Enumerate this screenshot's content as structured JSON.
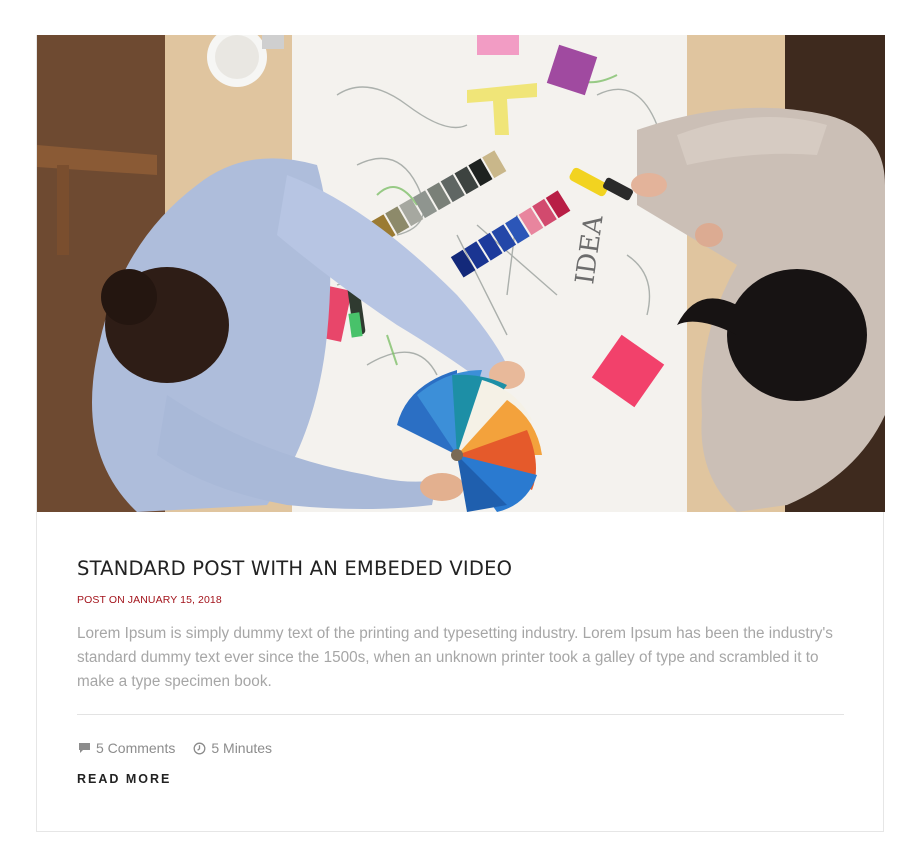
{
  "post": {
    "title": "STANDARD POST WITH AN EMBEDED VIDEO",
    "date_line": "POST ON JANUARY 15, 2018",
    "excerpt": "Lorem Ipsum is simply dummy text of the printing and typesetting industry. Lorem Ipsum has been the industry's standard dummy text ever since the 1500s, when an unknown printer took a galley of type and scrambled it to make a type specimen book.",
    "comments": "5 Comments",
    "read_time": "5 Minutes",
    "read_more": "READ MORE"
  },
  "media": {
    "sketch_word": "IDEA"
  },
  "icons": {
    "comments": "speech-bubble-icon",
    "read_time": "clock-icon"
  },
  "colors": {
    "date_accent": "#a3141c",
    "excerpt_text": "#a6a6a6",
    "title_text": "#222222"
  }
}
